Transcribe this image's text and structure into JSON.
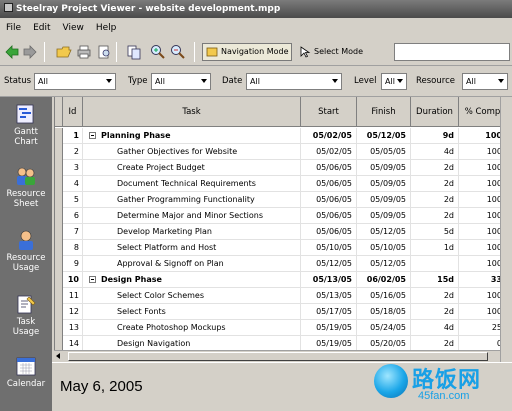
{
  "app": {
    "title": "Steelray Project Viewer - website development.mpp"
  },
  "menu": {
    "items": [
      "File",
      "Edit",
      "View",
      "Help"
    ]
  },
  "toolbar": {
    "navigation_mode": "Navigation Mode",
    "select_mode": "Select Mode",
    "search_value": ""
  },
  "filters": {
    "status_label": "Status",
    "status_value": "All",
    "type_label": "Type",
    "type_value": "All",
    "date_label": "Date",
    "date_value": "All",
    "level_label": "Level",
    "level_value": "All",
    "resource_label": "Resource",
    "resource_value": "All"
  },
  "sidebar": {
    "items": [
      {
        "label1": "Gantt",
        "label2": "Chart",
        "icon": "gantt-chart-icon"
      },
      {
        "label1": "Resource",
        "label2": "Sheet",
        "icon": "resource-sheet-icon"
      },
      {
        "label1": "Resource",
        "label2": "Usage",
        "icon": "resource-usage-icon"
      },
      {
        "label1": "Task",
        "label2": "Usage",
        "icon": "task-usage-icon"
      },
      {
        "label1": "Calendar",
        "label2": "",
        "icon": "calendar-icon"
      }
    ]
  },
  "table": {
    "columns": {
      "id": "Id",
      "task": "Task",
      "start": "Start",
      "finish": "Finish",
      "duration": "Duration",
      "pct": "% Comp"
    },
    "rows": [
      {
        "id": "1",
        "task": "Planning Phase",
        "start": "05/02/05",
        "finish": "05/12/05",
        "duration": "9d",
        "pct": "100",
        "summary": true
      },
      {
        "id": "2",
        "task": "Gather Objectives for Website",
        "start": "05/02/05",
        "finish": "05/05/05",
        "duration": "4d",
        "pct": "100"
      },
      {
        "id": "3",
        "task": "Create Project Budget",
        "start": "05/06/05",
        "finish": "05/09/05",
        "duration": "2d",
        "pct": "100"
      },
      {
        "id": "4",
        "task": "Document Technical Requirements",
        "start": "05/06/05",
        "finish": "05/09/05",
        "duration": "2d",
        "pct": "100"
      },
      {
        "id": "5",
        "task": "Gather Programming Functionality",
        "start": "05/06/05",
        "finish": "05/09/05",
        "duration": "2d",
        "pct": "100"
      },
      {
        "id": "6",
        "task": "Determine Major and Minor Sections",
        "start": "05/06/05",
        "finish": "05/09/05",
        "duration": "2d",
        "pct": "100"
      },
      {
        "id": "7",
        "task": "Develop Marketing Plan",
        "start": "05/06/05",
        "finish": "05/12/05",
        "duration": "5d",
        "pct": "100"
      },
      {
        "id": "8",
        "task": "Select Platform and Host",
        "start": "05/10/05",
        "finish": "05/10/05",
        "duration": "1d",
        "pct": "100"
      },
      {
        "id": "9",
        "task": "Approval & Signoff on Plan",
        "start": "05/12/05",
        "finish": "05/12/05",
        "duration": "",
        "pct": "100"
      },
      {
        "id": "10",
        "task": "Design Phase",
        "start": "05/13/05",
        "finish": "06/02/05",
        "duration": "15d",
        "pct": "33",
        "summary": true
      },
      {
        "id": "11",
        "task": "Select Color Schemes",
        "start": "05/13/05",
        "finish": "05/16/05",
        "duration": "2d",
        "pct": "100"
      },
      {
        "id": "12",
        "task": "Select Fonts",
        "start": "05/17/05",
        "finish": "05/18/05",
        "duration": "2d",
        "pct": "100"
      },
      {
        "id": "13",
        "task": "Create Photoshop Mockups",
        "start": "05/19/05",
        "finish": "05/24/05",
        "duration": "4d",
        "pct": "25"
      },
      {
        "id": "14",
        "task": "Design Navigation",
        "start": "05/19/05",
        "finish": "05/20/05",
        "duration": "2d",
        "pct": "0"
      }
    ]
  },
  "status": {
    "date": "May 6, 2005"
  },
  "watermark": {
    "text": "路饭网",
    "url": "45fan.com"
  }
}
